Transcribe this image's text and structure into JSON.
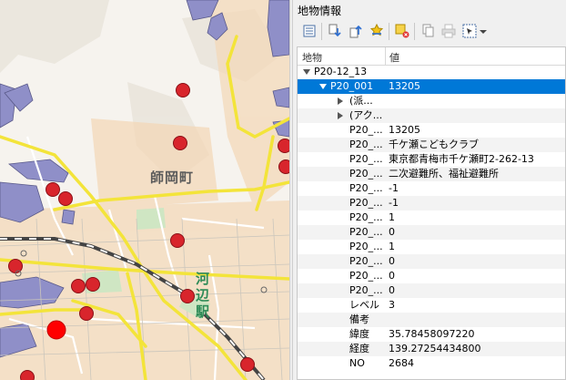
{
  "panel": {
    "title": "地物情報",
    "columns": {
      "feature": "地物",
      "value": "値"
    }
  },
  "toolbar": {
    "icons": [
      "expand-tree-icon",
      "collapse-tree-icon",
      "expand-new-icon",
      "collapse-all-icon",
      "highlight-icon",
      "clear-results-icon",
      "copy-icon",
      "print-icon",
      "select-mode-icon",
      "dropdown-icon"
    ]
  },
  "map": {
    "label_town": "師岡町",
    "label_station": "河辺駅"
  },
  "tree": {
    "layer": "P20-12_13",
    "feature": {
      "key": "P20_001",
      "value": "13205"
    },
    "groups": [
      {
        "key": "(派..."
      },
      {
        "key": "(アク..."
      }
    ],
    "attributes": [
      {
        "key": "P20_...",
        "value": "13205"
      },
      {
        "key": "P20_...",
        "value": "千ケ瀬こどもクラブ"
      },
      {
        "key": "P20_...",
        "value": "東京都青梅市千ケ瀬町2-262-13"
      },
      {
        "key": "P20_...",
        "value": "二次避難所、福祉避難所"
      },
      {
        "key": "P20_...",
        "value": "-1"
      },
      {
        "key": "P20_...",
        "value": "-1"
      },
      {
        "key": "P20_...",
        "value": "1"
      },
      {
        "key": "P20_...",
        "value": "0"
      },
      {
        "key": "P20_...",
        "value": "1"
      },
      {
        "key": "P20_...",
        "value": "0"
      },
      {
        "key": "P20_...",
        "value": "0"
      },
      {
        "key": "P20_...",
        "value": "0"
      },
      {
        "key": "レベル",
        "value": "3"
      },
      {
        "key": "備考",
        "value": ""
      },
      {
        "key": "緯度",
        "value": "35.78458097220"
      },
      {
        "key": "経度",
        "value": "139.27254434800"
      },
      {
        "key": "NO",
        "value": "2684"
      }
    ]
  }
}
